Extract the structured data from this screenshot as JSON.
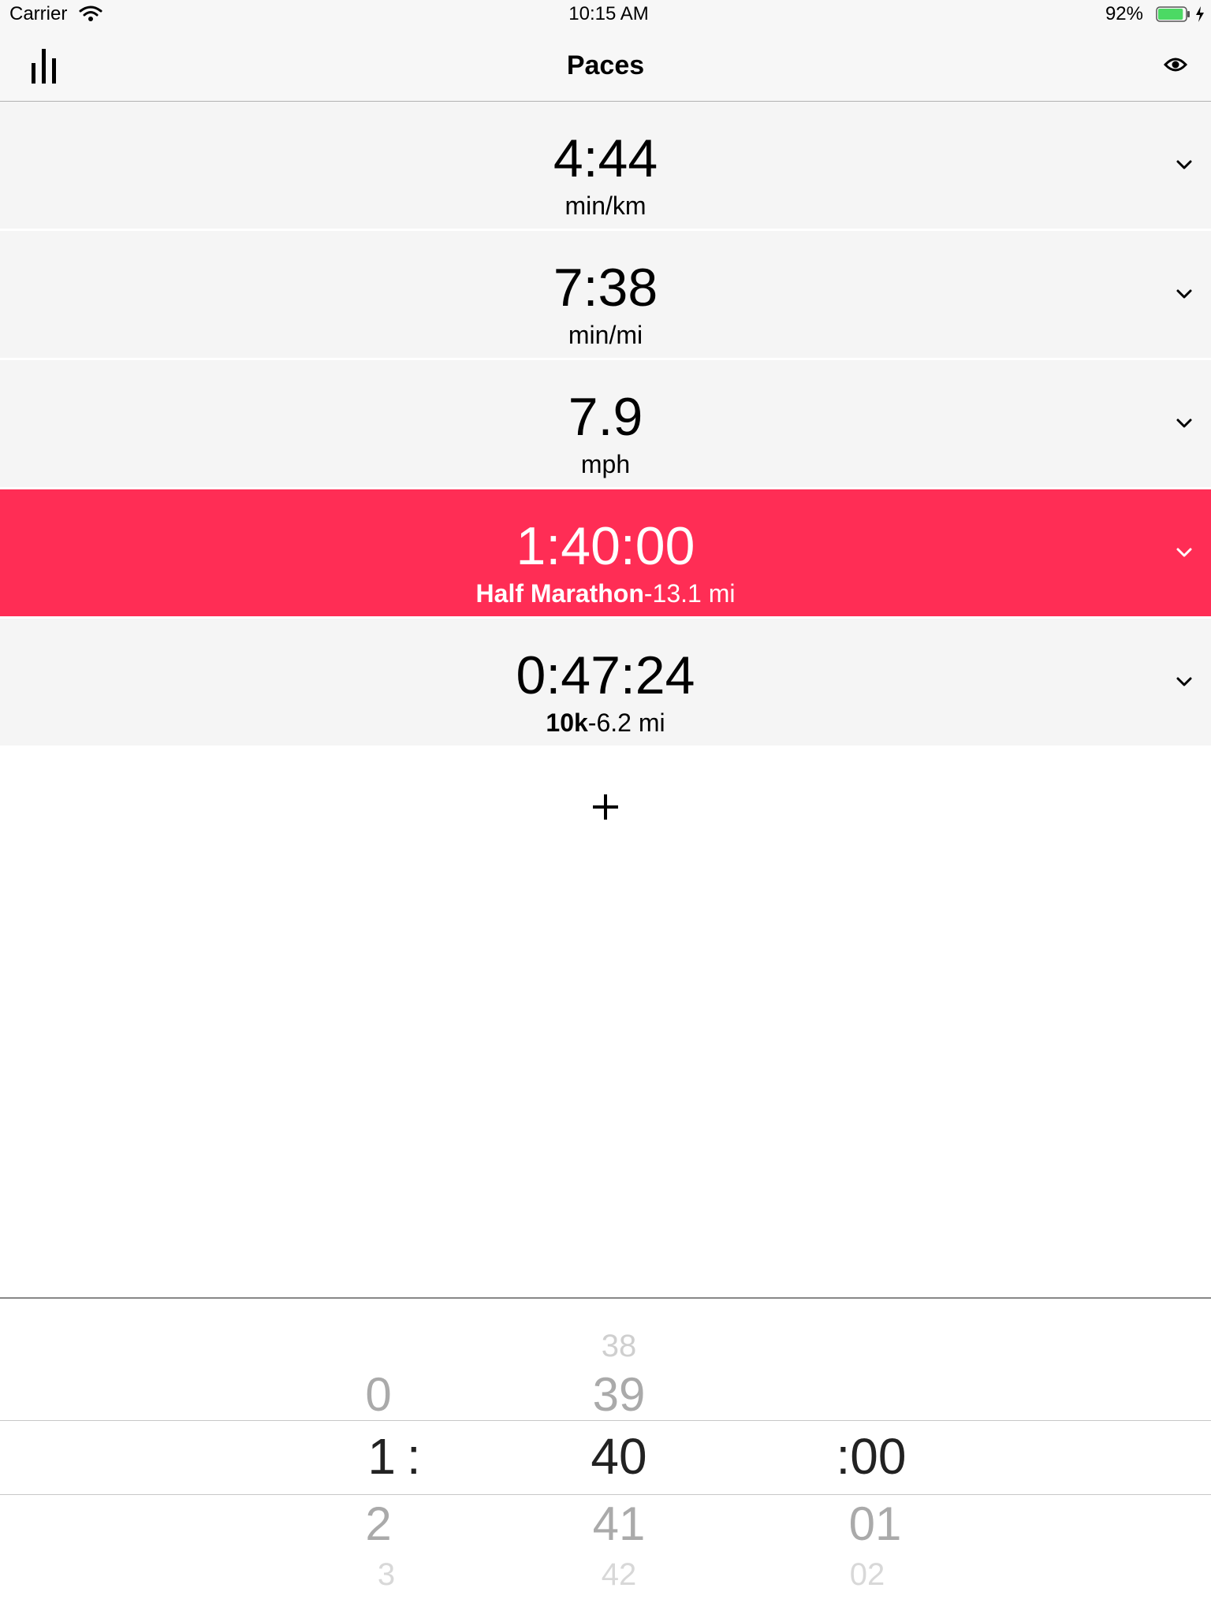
{
  "status_bar": {
    "carrier": "Carrier",
    "time": "10:15 AM",
    "battery_percent": "92%",
    "battery_level": 0.92,
    "battery_color": "#4cd964"
  },
  "nav": {
    "title": "Paces",
    "left_icon": "stats-icon",
    "right_icon": "eye-icon"
  },
  "accent_color": "#ff2d55",
  "rows": [
    {
      "value": "4:44",
      "unit": "min/km"
    },
    {
      "value": "7:38",
      "unit": "min/mi"
    },
    {
      "value": "7.9",
      "unit": "mph"
    },
    {
      "value": "1:40:00",
      "race": "Half Marathon",
      "distance": "-13.1 mi",
      "selected": true
    },
    {
      "value": "0:47:24",
      "race": "10k",
      "distance": "-6.2 mi"
    }
  ],
  "add_label": "+",
  "picker": {
    "hours": {
      "above": "0",
      "selected": "1",
      "below": "2",
      "below2": "3",
      "separator": ":"
    },
    "minutes": {
      "above2": "38",
      "above": "39",
      "selected": "40",
      "below": "41",
      "below2": "42"
    },
    "seconds": {
      "separator": ":",
      "selected": "00",
      "below": "01",
      "below2": "02"
    }
  }
}
